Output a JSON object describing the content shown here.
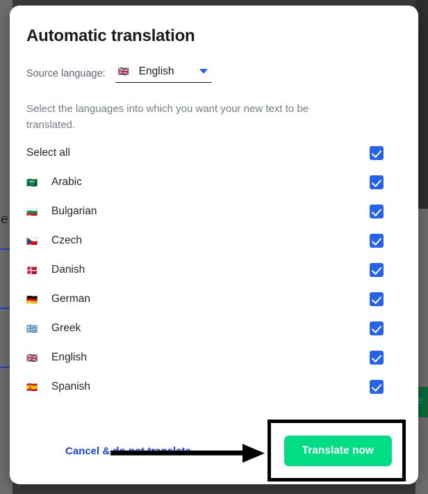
{
  "modal": {
    "title": "Automatic translation",
    "source": {
      "label": "Source language:",
      "flag": "🇬🇧",
      "value": "English",
      "caret_icon": "chevron-down-icon"
    },
    "intro": "Select the languages into which you want your new text to be translated.",
    "select_all": {
      "label": "Select all",
      "checked": true
    },
    "languages": [
      {
        "flag": "🇸🇦",
        "name": "Arabic",
        "checked": true
      },
      {
        "flag": "🇧🇬",
        "name": "Bulgarian",
        "checked": true
      },
      {
        "flag": "🇨🇿",
        "name": "Czech",
        "checked": true
      },
      {
        "flag": "🇩🇰",
        "name": "Danish",
        "checked": true
      },
      {
        "flag": "🇩🇪",
        "name": "German",
        "checked": true
      },
      {
        "flag": "🇬🇷",
        "name": "Greek",
        "checked": true
      },
      {
        "flag": "🇬🇧",
        "name": "English",
        "checked": true
      },
      {
        "flag": "🇪🇸",
        "name": "Spanish",
        "checked": true
      }
    ],
    "footer": {
      "cancel_label": "Cancel & do not translate",
      "submit_label": "Translate now"
    }
  },
  "annotation": {
    "arrow_icon": "arrow-right-pointer",
    "highlight_target": "Translate now"
  },
  "background": {
    "left_glyph": "e",
    "right_glyph": "e"
  },
  "colors": {
    "accent_blue": "#2563eb",
    "link_blue": "#1a42e8",
    "submit_green": "#00dd84",
    "overlay": "#3b3b3b",
    "title_text": "#1b1b1b",
    "muted_text": "#767c87"
  }
}
